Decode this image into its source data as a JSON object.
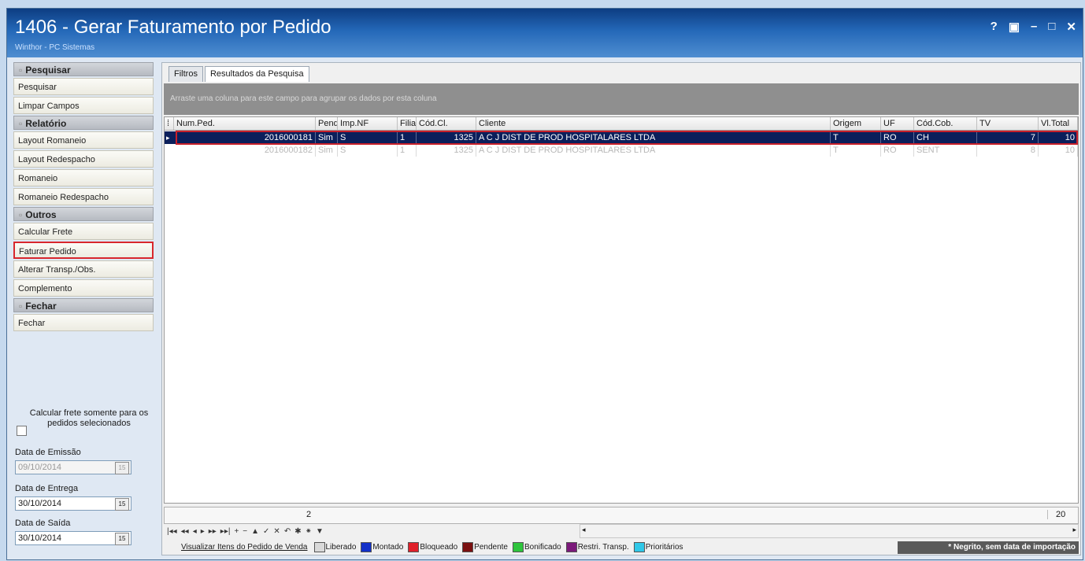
{
  "window": {
    "title": "1406 - Gerar Faturamento por Pedido",
    "subtitle": "Winthor - PC Sistemas",
    "controls": [
      "?",
      "▣",
      "–",
      "□",
      "✕"
    ]
  },
  "sidebar": {
    "sections": [
      {
        "title": "Pesquisar",
        "items": [
          "Pesquisar",
          "Limpar Campos"
        ]
      },
      {
        "title": "Relatório",
        "items": [
          "Layout Romaneio",
          "Layout Redespacho",
          "Romaneio",
          "Romaneio Redespacho"
        ]
      },
      {
        "title": "Outros",
        "items": [
          "Calcular Frete",
          "Faturar Pedido",
          "Alterar Transp./Obs.",
          "Complemento"
        ]
      },
      {
        "title": "Fechar",
        "items": [
          "Fechar"
        ]
      }
    ],
    "highlighted_item": "Faturar Pedido",
    "checkbox_label": "Calcular frete somente para os pedidos selecionados",
    "data_emissao_label": "Data de Emissão",
    "data_emissao_value": "09/10/2014",
    "data_entrega_label": "Data de Entrega",
    "data_entrega_value": "30/10/2014",
    "data_saida_label": "Data de Saída",
    "data_saida_value": "30/10/2014"
  },
  "tabs": [
    "Filtros",
    "Resultados da Pesquisa"
  ],
  "active_tab": "Resultados da Pesquisa",
  "group_hint": "Arraste uma coluna para este campo para agrupar os dados por esta coluna",
  "grid": {
    "columns": [
      "Num.Ped.",
      "Pend",
      "Imp.NF",
      "Filia",
      "Cód.Cl.",
      "Cliente",
      "Origem",
      "UF",
      "Cód.Cob.",
      "TV",
      "Vl.Total"
    ],
    "rows": [
      {
        "num_ped": "2016000181",
        "pend": "Sim",
        "imp_nf": "S",
        "filial": "1",
        "cod_cl": "1325",
        "cliente": "A C J DIST DE PROD HOSPITALARES LTDA",
        "origem": "T",
        "uf": "RO",
        "cod_cob": "CH",
        "tv": "7",
        "vl_total": "10"
      },
      {
        "num_ped": "2016000182",
        "pend": "Sim",
        "imp_nf": "S",
        "filial": "1",
        "cod_cl": "1325",
        "cliente": "A C J DIST DE PROD HOSPITALARES LTDA",
        "origem": "T",
        "uf": "RO",
        "cod_cob": "SENT",
        "tv": "8",
        "vl_total": "10"
      }
    ],
    "summary_count": "2",
    "summary_total": "20"
  },
  "navigator": [
    "|◂◂",
    "◂◂",
    "◂",
    "▸",
    "▸▸",
    "▸▸|",
    "+",
    "−",
    "▲",
    "✓",
    "✕",
    "↶",
    "✱",
    "⁕",
    "▼"
  ],
  "legend": {
    "link": "Visualizar Itens do Pedido de Venda",
    "items": [
      {
        "label": "Liberado",
        "color": "#d9d9d9"
      },
      {
        "label": "Montado",
        "color": "#1230c8"
      },
      {
        "label": "Bloqueado",
        "color": "#e0202a"
      },
      {
        "label": "Pendente",
        "color": "#7a1010"
      },
      {
        "label": "Bonificado",
        "color": "#2ec43c"
      },
      {
        "label": "Restri. Transp.",
        "color": "#7b1a7a"
      },
      {
        "label": "Prioritários",
        "color": "#30c8e8"
      }
    ],
    "note": "* Negrito, sem data de importação"
  }
}
